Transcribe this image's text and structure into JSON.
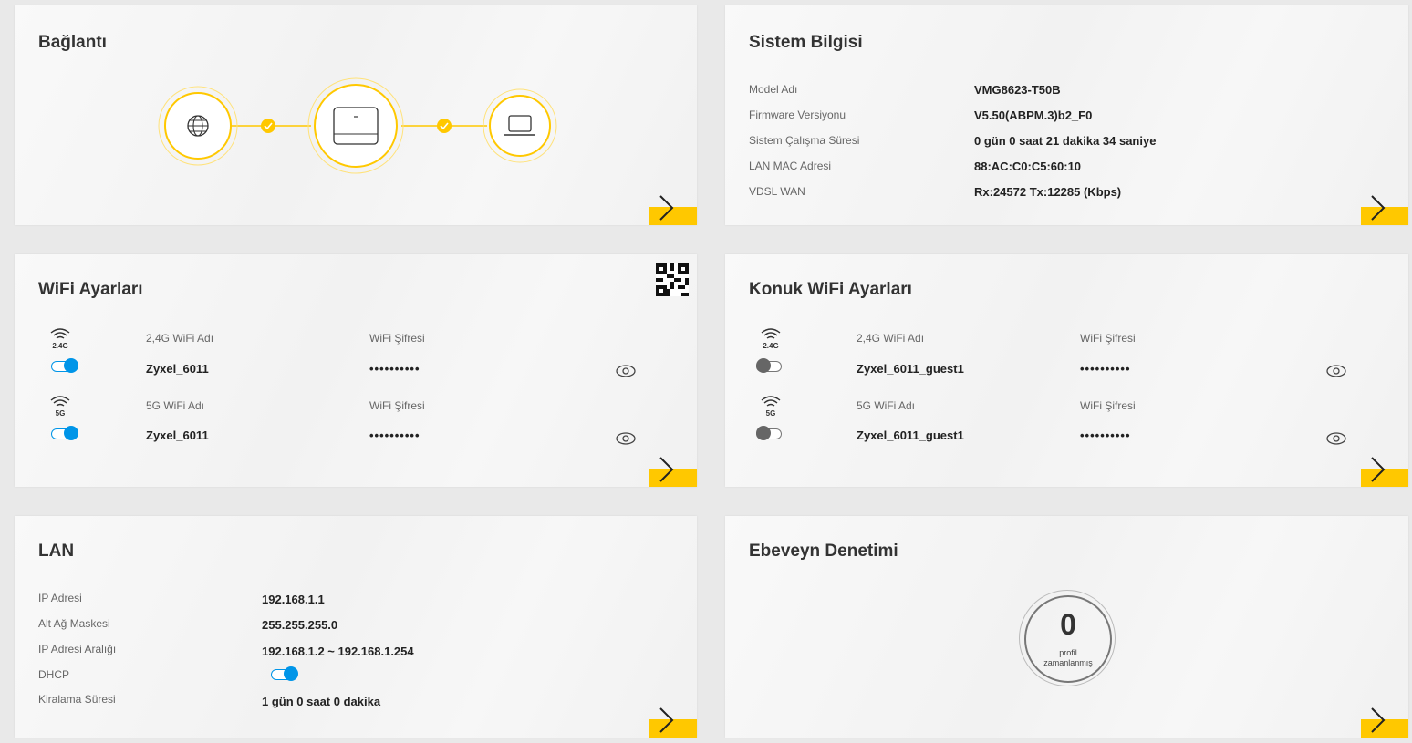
{
  "connection": {
    "title": "Bağlantı",
    "status_color": "#ffc800"
  },
  "system": {
    "title": "Sistem Bilgisi",
    "rows": [
      {
        "label": "Model Adı",
        "value": "VMG8623-T50B"
      },
      {
        "label": "Firmware Versiyonu",
        "value": "V5.50(ABPM.3)b2_F0"
      },
      {
        "label": "Sistem Çalışma Süresi",
        "value": "0 gün 0 saat 21 dakika 34 saniye"
      },
      {
        "label": "LAN MAC Adresi",
        "value": "88:AC:C0:C5:60:10"
      },
      {
        "label": "VDSL WAN",
        "value": "Rx:24572 Tx:12285 (Kbps)"
      }
    ]
  },
  "wifi": {
    "title": "WiFi Ayarları",
    "bands": [
      {
        "badge": "2.4G",
        "name_label": "2,4G WiFi Adı",
        "name": "Zyxel_6011",
        "pw_label": "WiFi Şifresi",
        "pw": "••••••••••",
        "enabled": true
      },
      {
        "badge": "5G",
        "name_label": "5G WiFi Adı",
        "name": "Zyxel_6011",
        "pw_label": "WiFi Şifresi",
        "pw": "••••••••••",
        "enabled": true
      }
    ]
  },
  "guest_wifi": {
    "title": "Konuk WiFi Ayarları",
    "bands": [
      {
        "badge": "2.4G",
        "name_label": "2,4G WiFi Adı",
        "name": "Zyxel_6011_guest1",
        "pw_label": "WiFi Şifresi",
        "pw": "••••••••••",
        "enabled": false
      },
      {
        "badge": "5G",
        "name_label": "5G WiFi Adı",
        "name": "Zyxel_6011_guest1",
        "pw_label": "WiFi Şifresi",
        "pw": "••••••••••",
        "enabled": false
      }
    ]
  },
  "lan": {
    "title": "LAN",
    "rows": [
      {
        "label": "IP Adresi",
        "value": "192.168.1.1"
      },
      {
        "label": "Alt Ağ Maskesi",
        "value": "255.255.255.0"
      },
      {
        "label": "IP Adresi Aralığı",
        "value": "192.168.1.2 ~ 192.168.1.254"
      },
      {
        "label": "DHCP",
        "value": ""
      },
      {
        "label": "Kiralama Süresi",
        "value": "1 gün 0 saat 0 dakika"
      }
    ],
    "dhcp_enabled": true
  },
  "parental": {
    "title": "Ebeveyn Denetimi",
    "count": "0",
    "caption_line1": "profil",
    "caption_line2": "zamanlanmış"
  },
  "colors": {
    "accent": "#ffc800",
    "toggle_on": "#0095e8",
    "toggle_off": "#666666"
  }
}
